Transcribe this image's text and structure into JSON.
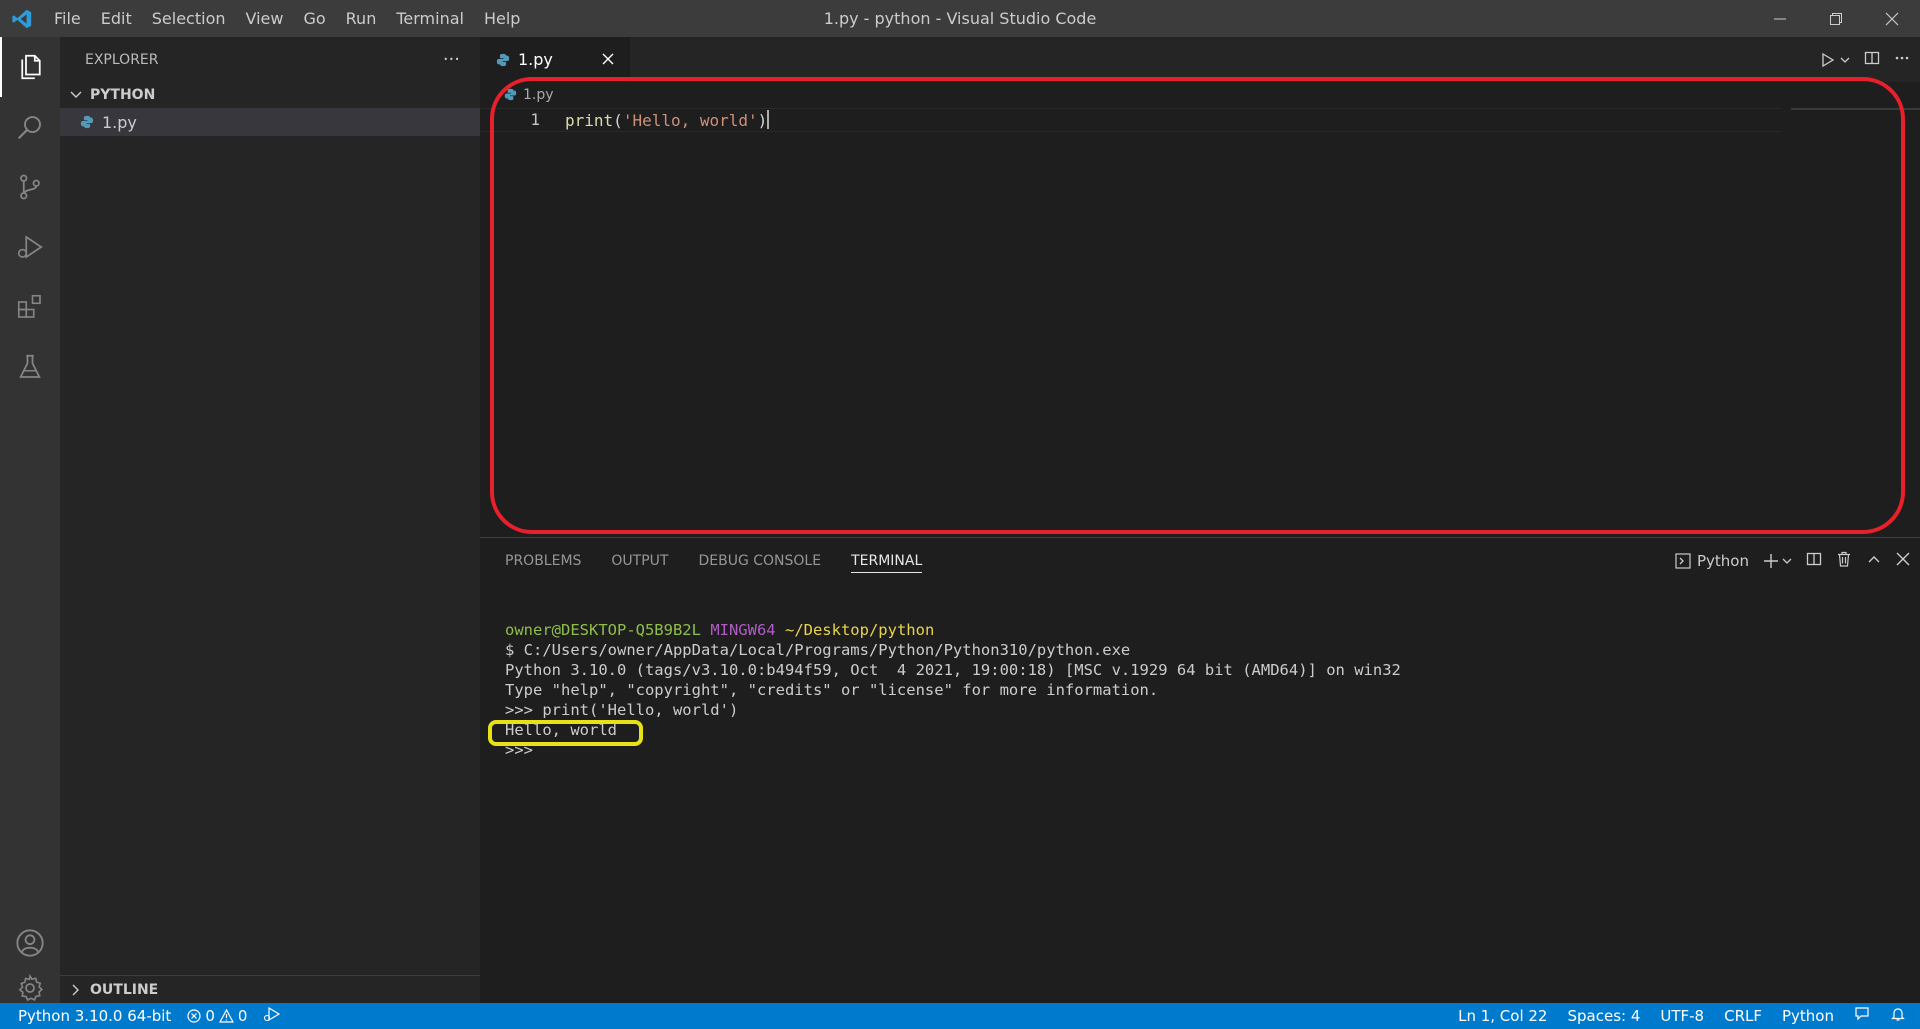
{
  "window": {
    "title": "1.py - python - Visual Studio Code",
    "menu": [
      "File",
      "Edit",
      "Selection",
      "View",
      "Go",
      "Run",
      "Terminal",
      "Help"
    ]
  },
  "sidebar": {
    "title": "EXPLORER",
    "more": "···",
    "folder": "PYTHON",
    "file": "1.py",
    "outline": "OUTLINE"
  },
  "editor": {
    "tab_label": "1.py",
    "breadcrumb": "1.py",
    "line_number": "1",
    "code": {
      "fn": "print",
      "open": "(",
      "str": "'Hello, world'",
      "close": ")"
    }
  },
  "panel": {
    "tabs": [
      "PROBLEMS",
      "OUTPUT",
      "DEBUG CONSOLE",
      "TERMINAL"
    ],
    "active_tab": "TERMINAL",
    "terminal_name": "Python",
    "terminal": {
      "user_host": "owner@DESKTOP-Q5B9B2L",
      "shell": "MINGW64",
      "path": "~/Desktop/python",
      "lines": [
        "$ C:/Users/owner/AppData/Local/Programs/Python/Python310/python.exe",
        "Python 3.10.0 (tags/v3.10.0:b494f59, Oct  4 2021, 19:00:18) [MSC v.1929 64 bit (AMD64)] on win32",
        "Type \"help\", \"copyright\", \"credits\" or \"license\" for more information.",
        ">>> print('Hello, world')",
        "Hello, world",
        ">>>"
      ]
    }
  },
  "statusbar": {
    "interpreter": "Python 3.10.0 64-bit",
    "errors": "0",
    "warnings": "0",
    "position": "Ln 1, Col 22",
    "spaces": "Spaces: 4",
    "encoding": "UTF-8",
    "eol": "CRLF",
    "language": "Python"
  },
  "colors": {
    "accent": "#007acc",
    "annotation_red": "#e8202b",
    "annotation_yellow": "#e6e215"
  }
}
